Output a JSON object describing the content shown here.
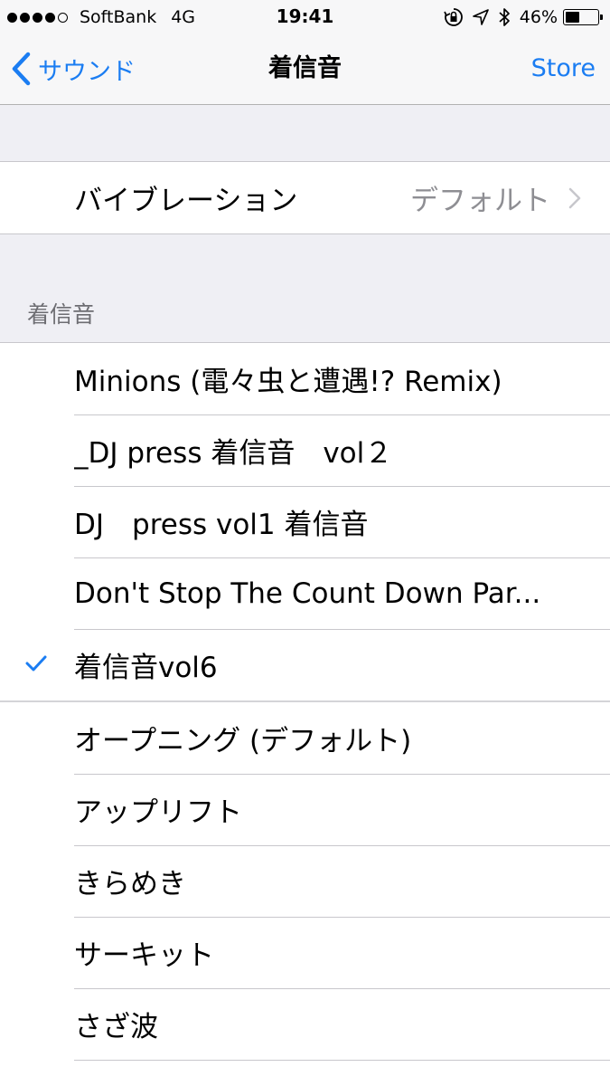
{
  "status_bar": {
    "carrier": "SoftBank",
    "network": "4G",
    "time": "19:41",
    "battery_percent": "46%",
    "battery_level": 0.46,
    "icons": [
      "orientation-lock-icon",
      "location-arrow-icon",
      "bluetooth-icon",
      "battery-icon"
    ]
  },
  "nav": {
    "back_label": "サウンド",
    "title": "着信音",
    "right_label": "Store",
    "accent_color": "#1b7df2"
  },
  "vibration": {
    "label": "バイブレーション",
    "value": "デフォルト"
  },
  "ringtone_section": {
    "header": "着信音",
    "custom_items": [
      "Minions (電々虫と遭遇!? Remix)",
      "_DJ press 着信音　vol２",
      "DJ　press vol1 着信音",
      "Don't Stop The Count Down Par...",
      "着信音vol6"
    ],
    "selected": "着信音vol6",
    "builtin_items": [
      "オープニング (デフォルト)",
      "アップリフト",
      "きらめき",
      "サーキット",
      "さざ波"
    ]
  }
}
